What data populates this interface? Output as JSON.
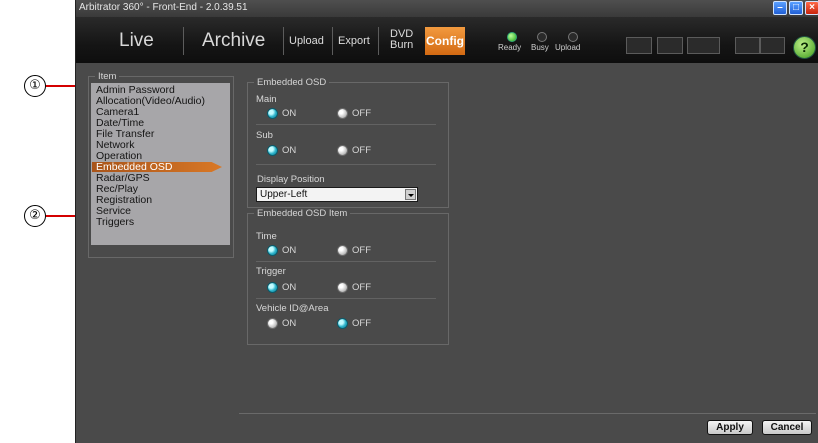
{
  "callouts": [
    "①",
    "②"
  ],
  "window": {
    "title": "Arbitrator 360° - Front-End - 2.0.39.51",
    "controls": [
      "minimize-icon",
      "maximize-icon",
      "close-icon"
    ]
  },
  "toolbar": {
    "live": "Live",
    "archive": "Archive",
    "upload": "Upload",
    "export": "Export",
    "dvd_line1": "DVD",
    "dvd_line2": "Burn",
    "config": "Config",
    "status": [
      {
        "label": "Ready",
        "active": true
      },
      {
        "label": "Busy",
        "active": false
      },
      {
        "label": "Upload",
        "active": false
      }
    ],
    "help": "?"
  },
  "item_panel": {
    "legend": "Item",
    "items": [
      "Admin Password",
      "Allocation(Video/Audio)",
      "Camera1",
      "Date/Time",
      "File Transfer",
      "Network",
      "Operation",
      "Embedded OSD",
      "Radar/GPS",
      "Rec/Play",
      "Registration",
      "Service",
      "Triggers"
    ],
    "selected": "Embedded OSD"
  },
  "osd": {
    "legend": "Embedded OSD",
    "main_label": "Main",
    "main_value": "ON",
    "sub_label": "Sub",
    "sub_value": "ON",
    "position_label": "Display Position",
    "position_value": "Upper-Left"
  },
  "osd_item": {
    "legend": "Embedded OSD Item",
    "time_label": "Time",
    "time_value": "ON",
    "trigger_label": "Trigger",
    "trigger_value": "ON",
    "vehicle_label": "Vehicle ID@Area",
    "vehicle_value": "OFF"
  },
  "options": {
    "on": "ON",
    "off": "OFF"
  },
  "buttons": {
    "apply": "Apply",
    "cancel": "Cancel"
  },
  "colors": {
    "accent": "#e07d24",
    "radio_on": "#2bb4cc",
    "callout_line": "#d40000"
  }
}
